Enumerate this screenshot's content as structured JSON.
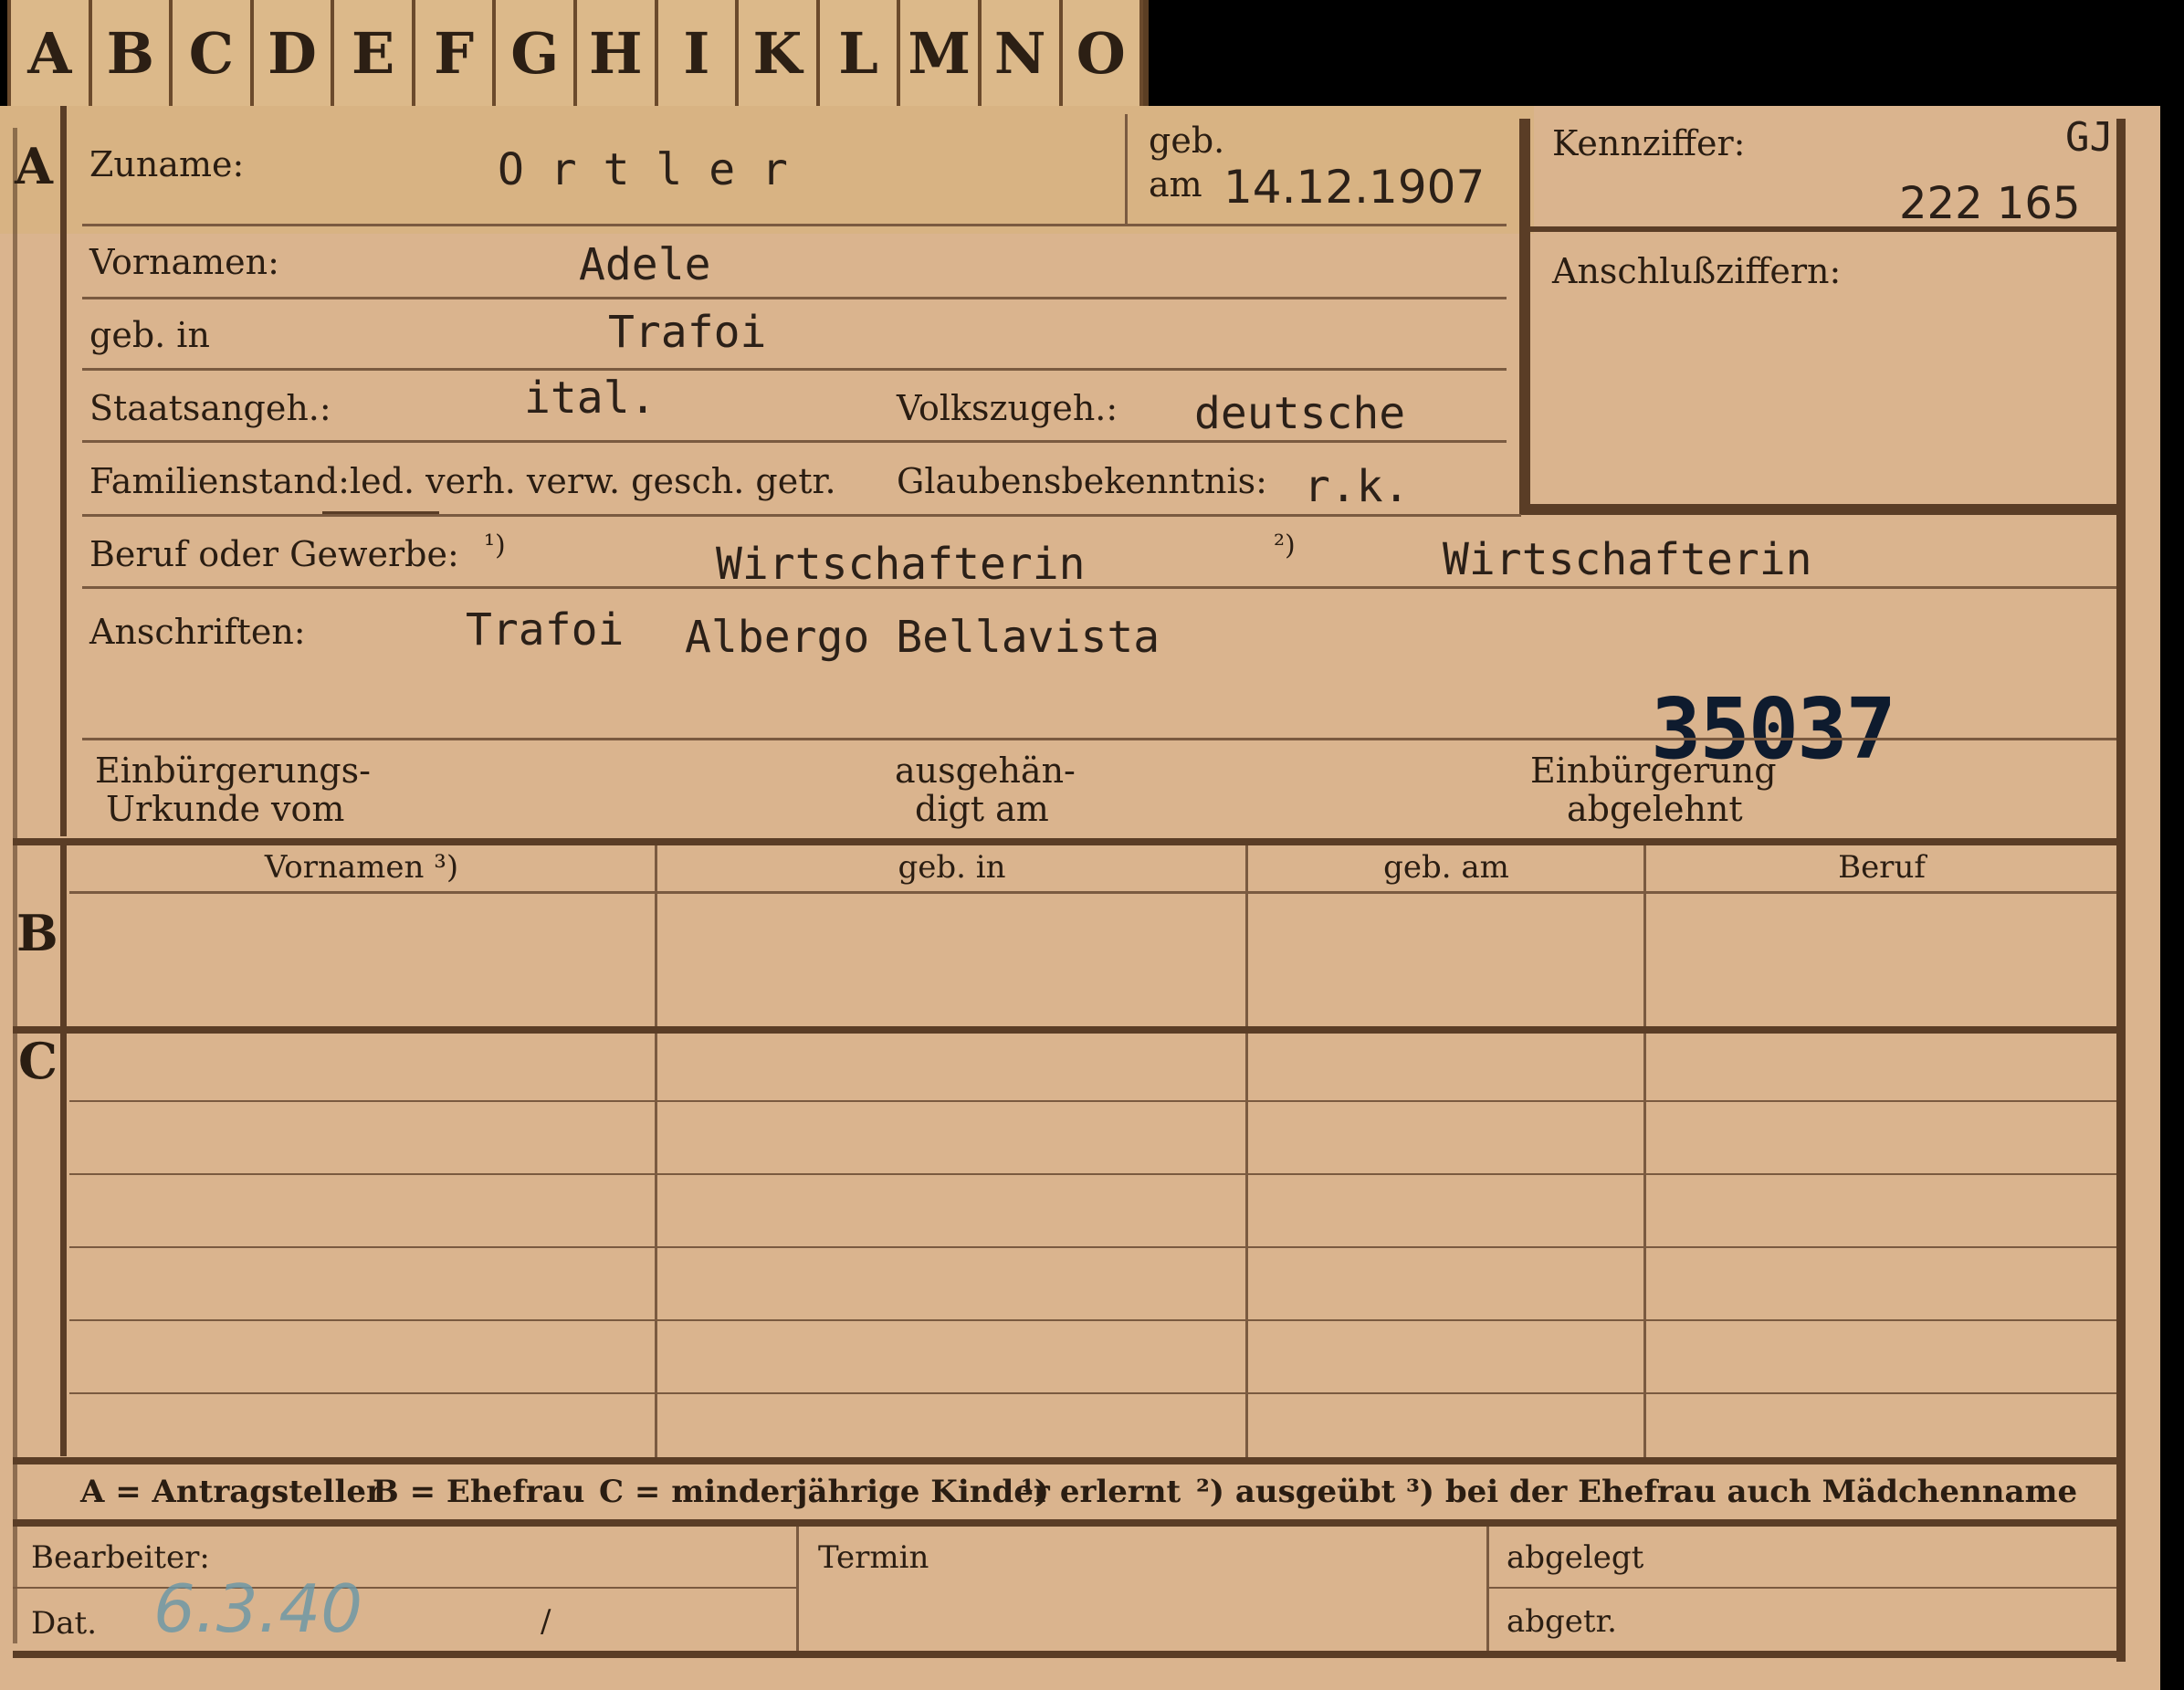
{
  "index_tabs": [
    "A",
    "B",
    "C",
    "D",
    "E",
    "F",
    "G",
    "H",
    "I",
    "K",
    "L",
    "M",
    "N",
    "O"
  ],
  "sections": {
    "a": "A",
    "b": "B",
    "c": "C"
  },
  "header": {
    "surname_label": "Zuname:",
    "surname": "O r t l e r",
    "birth_label_top": "geb.",
    "birth_label_bottom": "am",
    "birth_date": "14.12.1907",
    "id_label": "Kennziffer:",
    "id_prefix": "GJ",
    "id_number": "222 165",
    "connection_label": "Anschlußziffern:"
  },
  "person": {
    "first_names_label": "Vornamen:",
    "first_names": "Adele",
    "birthplace_label": "geb. in",
    "birthplace": "Trafoi",
    "citizenship_label": "Staatsangeh.:",
    "citizenship": "ital.",
    "ethnicity_label": "Volkszugeh.:",
    "ethnicity": "deutsche",
    "marital_label": "Familienstand:",
    "marital_options": "led. verh. verw. gesch. getr.",
    "religion_label": "Glaubensbekenntnis:",
    "religion": "r.k.",
    "occupation_label": "Beruf oder Gewerbe:",
    "occ_mark_1": "¹)",
    "occupation_learned": "Wirtschafterin",
    "occ_mark_2": "²)",
    "occupation_practiced": "Wirtschafterin",
    "address_label": "Anschriften:",
    "address_1": "Trafoi",
    "address_2": "Albergo Bellavista",
    "stamp_number": "35037"
  },
  "naturalization": {
    "certificate_label_1": "Einbürgerungs-",
    "certificate_label_2": "Urkunde vom",
    "handed_label_1": "ausgehän-",
    "handed_label_2": "digt am",
    "rejected_label_1": "Einbürgerung",
    "rejected_label_2": "abgelehnt"
  },
  "table": {
    "headers": [
      "Vornamen ³)",
      "geb. in",
      "geb. am",
      "Beruf"
    ]
  },
  "legend": {
    "a": "A = Antragsteller",
    "b": "B = Ehefrau",
    "c": "C = minderjährige Kinder",
    "n1": "¹) erlernt",
    "n2": "²) ausgeübt",
    "n3": "³) bei der Ehefrau auch Mädchenname"
  },
  "footer": {
    "editor_label": "Bearbeiter:",
    "date_label": "Dat.",
    "date_value": "6.3.40",
    "date_slash": "/",
    "term_label": "Termin",
    "filed_label": "abgelegt",
    "removed_label": "abgetr."
  }
}
